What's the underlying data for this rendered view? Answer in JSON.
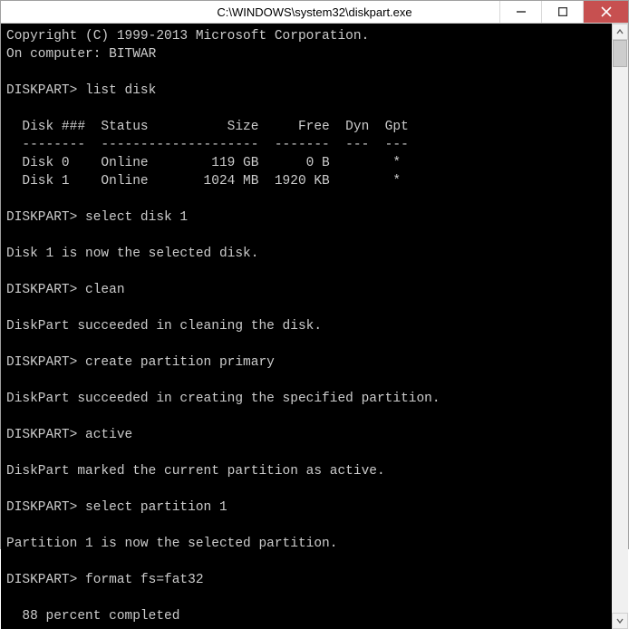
{
  "window": {
    "title": "C:\\WINDOWS\\system32\\diskpart.exe"
  },
  "console": {
    "copyright": "Copyright (C) 1999-2013 Microsoft Corporation.",
    "computer_line": "On computer: BITWAR",
    "prompt": "DISKPART>",
    "cmd_list_disk": "list disk",
    "table": {
      "headers": {
        "disk": "Disk ###",
        "status": "Status",
        "size": "Size",
        "free": "Free",
        "dyn": "Dyn",
        "gpt": "Gpt"
      },
      "sep": {
        "disk": "--------",
        "status": "-------------",
        "size": "-------",
        "free": "-------",
        "dyn": "---",
        "gpt": "---"
      },
      "rows": [
        {
          "disk": "Disk 0",
          "status": "Online",
          "size": "119 GB",
          "free": "0 B",
          "dyn": "",
          "gpt": "*"
        },
        {
          "disk": "Disk 1",
          "status": "Online",
          "size": "1024 MB",
          "free": "1920 KB",
          "dyn": "",
          "gpt": "*"
        }
      ]
    },
    "cmd_select_disk": "select disk 1",
    "msg_disk_selected": "Disk 1 is now the selected disk.",
    "cmd_clean": "clean",
    "msg_clean": "DiskPart succeeded in cleaning the disk.",
    "cmd_create_part": "create partition primary",
    "msg_create_part": "DiskPart succeeded in creating the specified partition.",
    "cmd_active": "active",
    "msg_active": "DiskPart marked the current partition as active.",
    "cmd_select_part": "select partition 1",
    "msg_part_selected": "Partition 1 is now the selected partition.",
    "cmd_format": "format fs=fat32",
    "progress": "88 percent completed"
  }
}
